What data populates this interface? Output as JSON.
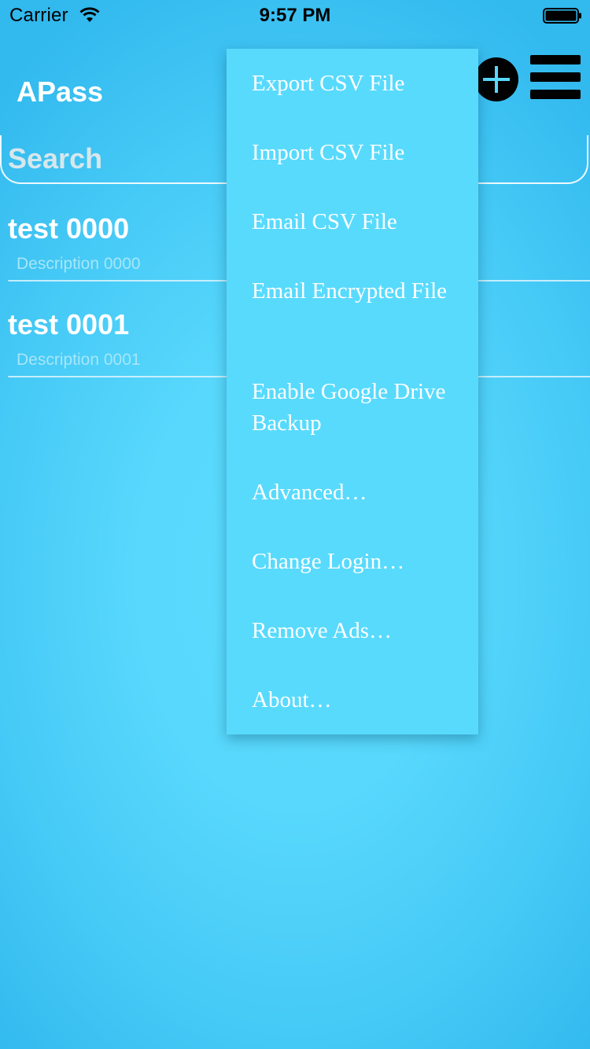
{
  "status_bar": {
    "carrier": "Carrier",
    "time": "9:57 PM"
  },
  "header": {
    "title": "APass",
    "add_icon": "plus-circle-icon",
    "menu_icon": "hamburger-menu-icon"
  },
  "search": {
    "placeholder": "Search",
    "value": ""
  },
  "list": {
    "items": [
      {
        "title": "test 0000",
        "description": "Description 0000"
      },
      {
        "title": "test 0001",
        "description": "Description 0001"
      }
    ]
  },
  "menu": {
    "items": [
      {
        "label": "Export CSV File"
      },
      {
        "label": "Import CSV File"
      },
      {
        "label": "Email CSV File"
      },
      {
        "label": "Email Encrypted File"
      },
      {
        "label": "Enable Google Drive Backup"
      },
      {
        "label": "Advanced…"
      },
      {
        "label": "Change Login…"
      },
      {
        "label": "Remove Ads…"
      },
      {
        "label": "About…"
      }
    ]
  },
  "colors": {
    "background": "#58d8fc",
    "menu_background": "#58dafd",
    "text": "#ffffff",
    "description_text": "#a6e6f8"
  }
}
